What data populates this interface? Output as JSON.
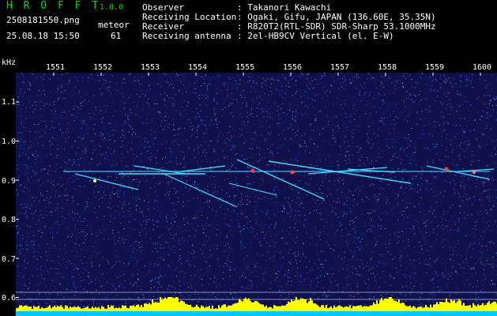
{
  "header": {
    "app_title": "H R O F F T",
    "version": "1.0.0",
    "filename": "2508181550.png",
    "datetime": "25.08.18 15:50",
    "mode_label": "meteor",
    "count": "61"
  },
  "info": [
    {
      "label": "Observer",
      "value": ": Takanori Kawachi"
    },
    {
      "label": "Receiving Location",
      "value": ": Ogaki, Gifu, JAPAN (136.60E, 35.35N)"
    },
    {
      "label": "Receiver",
      "value": ": R820T2(RTL-SDR) SDR-Sharp 53.1000MHz"
    },
    {
      "label": "Receiving antenna",
      "value": ": 2el-HB9CV Vertical (el. E-W)"
    }
  ],
  "axis": {
    "y_unit": "kHz",
    "y_ticks": [
      "1.1",
      "1.0",
      "0.9",
      "0.8",
      "0.7",
      "0.6"
    ],
    "x_ticks": [
      "1551",
      "1552",
      "1553",
      "1554",
      "1555",
      "1556",
      "1557",
      "1558",
      "1559",
      "1600"
    ]
  },
  "colors": {
    "background": "#10104a",
    "noise": "#4060ff",
    "trace": "#40e0ff",
    "hot": "#ff4040",
    "bars": "#ffff00",
    "baseline": "#00c8ff"
  }
}
